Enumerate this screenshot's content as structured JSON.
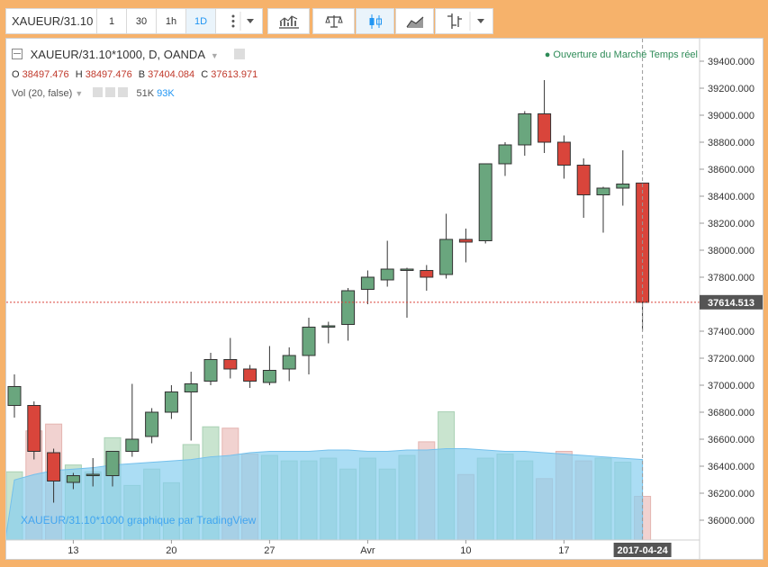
{
  "toolbar": {
    "symbol": "XAUEUR/31.10",
    "timeframes": [
      "1",
      "30",
      "1h",
      "1D"
    ],
    "active_timeframe": "1D"
  },
  "legend": {
    "title": "XAUEUR/31.10*1000, D, OANDA",
    "ohlc_label_o": "O",
    "ohlc_o": "38497.476",
    "ohlc_label_h": "H",
    "ohlc_h": "38497.476",
    "ohlc_label_b": "B",
    "ohlc_b": "37404.084",
    "ohlc_label_c": "C",
    "ohlc_c": "37613.971",
    "vol_label": "Vol (20, false)",
    "vol_value1": "51K",
    "vol_value2": "93K"
  },
  "market_status": "● Ouverture du Marché  Temps réel",
  "watermark": "XAUEUR/31.10*1000 graphique par TradingView",
  "colors": {
    "up": "#6aa67e",
    "down": "#d9453b",
    "volume_ma": "#87cef0"
  },
  "chart_data": {
    "type": "candlestick",
    "title": "XAUEUR/31.10*1000, D, OANDA",
    "ylim": [
      35900,
      39500
    ],
    "y_ticks": [
      36000,
      36200,
      36400,
      36600,
      36800,
      37000,
      37200,
      37400,
      37600,
      37800,
      38000,
      38200,
      38400,
      38600,
      38800,
      39000,
      39200,
      39400
    ],
    "x_tick_labels": [
      "13",
      "20",
      "27",
      "Avr",
      "10",
      "17"
    ],
    "x_tick_index": [
      3,
      8,
      13,
      18,
      23,
      28
    ],
    "current_price": "37614.513",
    "current_date": "2017-04-24",
    "candles": [
      {
        "o": 36850,
        "h": 37080,
        "l": 36760,
        "c": 36990
      },
      {
        "o": 36850,
        "h": 36880,
        "l": 36450,
        "c": 36510
      },
      {
        "o": 36500,
        "h": 36530,
        "l": 36130,
        "c": 36290
      },
      {
        "o": 36280,
        "h": 36350,
        "l": 36230,
        "c": 36330
      },
      {
        "o": 36330,
        "h": 36460,
        "l": 36250,
        "c": 36340
      },
      {
        "o": 36330,
        "h": 36500,
        "l": 36250,
        "c": 36510
      },
      {
        "o": 36510,
        "h": 37010,
        "l": 36470,
        "c": 36600
      },
      {
        "o": 36620,
        "h": 36830,
        "l": 36570,
        "c": 36800
      },
      {
        "o": 36800,
        "h": 37000,
        "l": 36750,
        "c": 36950
      },
      {
        "o": 36950,
        "h": 37100,
        "l": 36590,
        "c": 37010
      },
      {
        "o": 37030,
        "h": 37240,
        "l": 37000,
        "c": 37190
      },
      {
        "o": 37190,
        "h": 37350,
        "l": 37050,
        "c": 37120
      },
      {
        "o": 37120,
        "h": 37150,
        "l": 36980,
        "c": 37030
      },
      {
        "o": 37020,
        "h": 37290,
        "l": 37000,
        "c": 37110
      },
      {
        "o": 37120,
        "h": 37280,
        "l": 37030,
        "c": 37220
      },
      {
        "o": 37220,
        "h": 37500,
        "l": 37080,
        "c": 37430
      },
      {
        "o": 37430,
        "h": 37470,
        "l": 37310,
        "c": 37440
      },
      {
        "o": 37450,
        "h": 37720,
        "l": 37330,
        "c": 37700
      },
      {
        "o": 37710,
        "h": 37850,
        "l": 37600,
        "c": 37800
      },
      {
        "o": 37780,
        "h": 38070,
        "l": 37730,
        "c": 37860
      },
      {
        "o": 37850,
        "h": 37870,
        "l": 37500,
        "c": 37860
      },
      {
        "o": 37850,
        "h": 37890,
        "l": 37700,
        "c": 37800
      },
      {
        "o": 37820,
        "h": 38270,
        "l": 37790,
        "c": 38080
      },
      {
        "o": 38080,
        "h": 38160,
        "l": 37910,
        "c": 38060
      },
      {
        "o": 38070,
        "h": 38640,
        "l": 38050,
        "c": 38640
      },
      {
        "o": 38640,
        "h": 38800,
        "l": 38550,
        "c": 38780
      },
      {
        "o": 38780,
        "h": 39030,
        "l": 38700,
        "c": 39010
      },
      {
        "o": 39010,
        "h": 39260,
        "l": 38720,
        "c": 38800
      },
      {
        "o": 38800,
        "h": 38850,
        "l": 38530,
        "c": 38630
      },
      {
        "o": 38630,
        "h": 38680,
        "l": 38240,
        "c": 38410
      },
      {
        "o": 38410,
        "h": 38470,
        "l": 38130,
        "c": 38460
      },
      {
        "o": 38460,
        "h": 38740,
        "l": 38330,
        "c": 38490
      },
      {
        "o": 38497.476,
        "h": 38497.476,
        "l": 37404.084,
        "c": 37613.971
      }
    ],
    "volume_ylim": [
      0,
      130
    ],
    "volumes": [
      50,
      80,
      85,
      55,
      50,
      75,
      40,
      52,
      42,
      70,
      83,
      82,
      63,
      62,
      58,
      58,
      60,
      52,
      60,
      52,
      62,
      72,
      94,
      48,
      60,
      63,
      58,
      45,
      65,
      58,
      60,
      57,
      32
    ],
    "volume_ma": [
      44,
      48,
      51,
      52,
      53,
      55,
      56,
      57,
      58,
      59,
      61,
      62,
      64,
      65,
      65,
      65,
      66,
      66,
      65,
      65,
      66,
      66,
      67,
      67,
      66,
      65,
      65,
      64,
      63,
      62,
      61,
      60,
      59
    ]
  }
}
